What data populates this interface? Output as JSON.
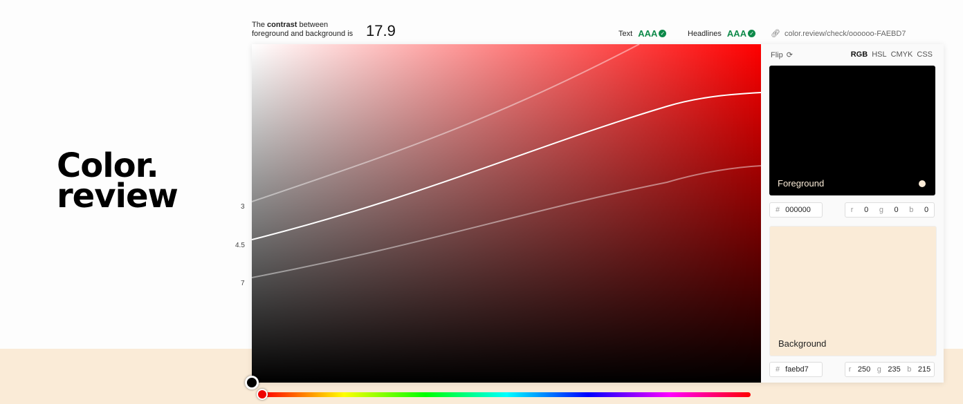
{
  "logo": {
    "line1": "Color.",
    "line2": "review"
  },
  "contrast": {
    "text_prefix": "The",
    "text_bold": "contrast",
    "text_rest": "between",
    "line2": "foreground and background is",
    "value": "17.9"
  },
  "ratings": {
    "text_label": "Text",
    "text_rating": "AAA",
    "headlines_label": "Headlines",
    "headlines_rating": "AAA"
  },
  "link": "color.review/check/oooooo-FAEBD7",
  "y_labels": [
    "3",
    "4.5",
    "7"
  ],
  "side": {
    "flip_label": "Flip",
    "modes": [
      "RGB",
      "HSL",
      "CMYK",
      "CSS"
    ],
    "active_mode": "RGB"
  },
  "foreground": {
    "label": "Foreground",
    "hex": "000000",
    "r_label": "r",
    "r": "0",
    "g_label": "g",
    "g": "0",
    "b_label": "b",
    "b": "0",
    "color": "#000000"
  },
  "background": {
    "label": "Background",
    "hex": "faebd7",
    "r_label": "r",
    "r": "250",
    "g_label": "g",
    "g": "235",
    "b_label": "b",
    "b": "215",
    "color": "#faebd7"
  },
  "icons": {
    "link": "link-icon",
    "flip": "refresh-icon",
    "check": "check-circle-icon"
  },
  "colors": {
    "pass": "#0e8a4a",
    "hue": "#ff0000"
  }
}
